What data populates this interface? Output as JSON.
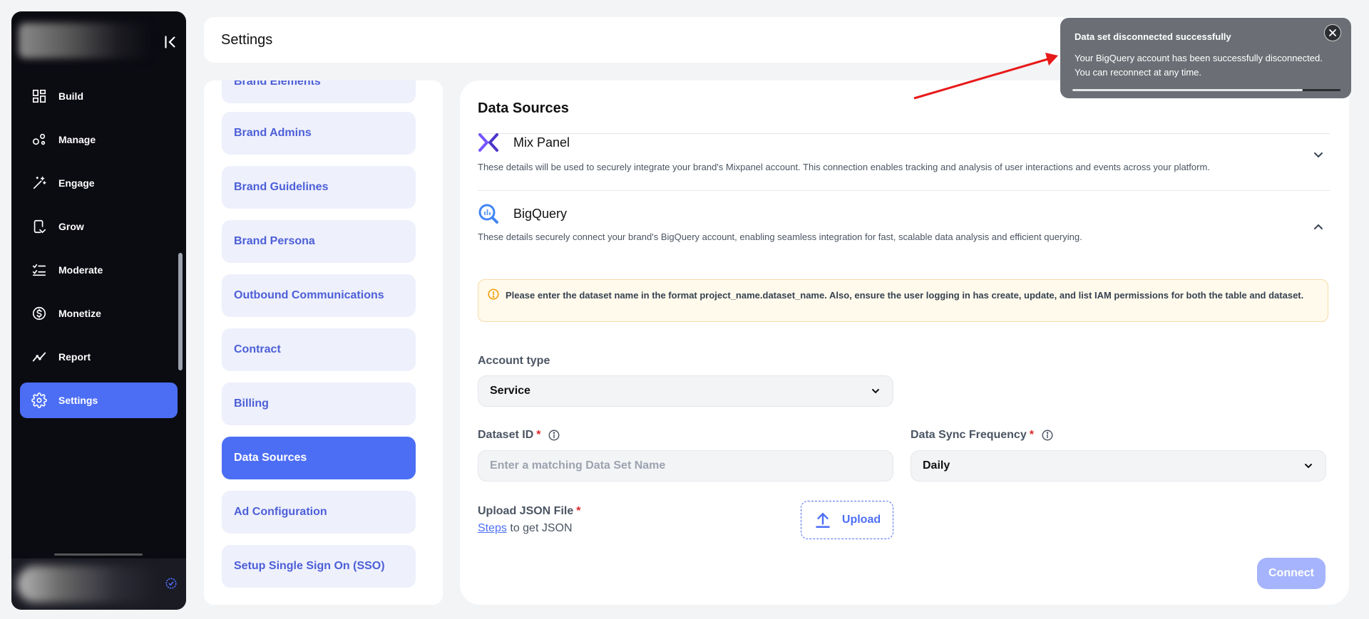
{
  "nav": {
    "items": [
      {
        "label": "Build",
        "icon": "grid-icon"
      },
      {
        "label": "Manage",
        "icon": "nodes-icon"
      },
      {
        "label": "Engage",
        "icon": "magic-wand-icon"
      },
      {
        "label": "Grow",
        "icon": "device-arrow-icon"
      },
      {
        "label": "Moderate",
        "icon": "checklist-icon"
      },
      {
        "label": "Monetize",
        "icon": "dollar-icon"
      },
      {
        "label": "Report",
        "icon": "trend-icon"
      },
      {
        "label": "Settings",
        "icon": "gear-icon",
        "active": true
      }
    ]
  },
  "header": {
    "title": "Settings"
  },
  "subnav": {
    "items": [
      {
        "label": "Brand Elements"
      },
      {
        "label": "Brand Admins"
      },
      {
        "label": "Brand Guidelines"
      },
      {
        "label": "Brand Persona"
      },
      {
        "label": "Outbound Communications"
      },
      {
        "label": "Contract"
      },
      {
        "label": "Billing"
      },
      {
        "label": "Data Sources",
        "active": true
      },
      {
        "label": "Ad Configuration"
      },
      {
        "label": "Setup Single Sign On (SSO)"
      }
    ]
  },
  "main": {
    "title": "Data Sources",
    "sources": [
      {
        "name": "Mix Panel",
        "description": "These details will be used to securely integrate your brand's Mixpanel account. This connection enables tracking and analysis of user interactions and events across your platform.",
        "expanded": false
      },
      {
        "name": "BigQuery",
        "description": "These details securely connect your brand's BigQuery account, enabling seamless integration for fast, scalable data analysis and efficient querying.",
        "expanded": true
      }
    ],
    "warning": "Please enter the dataset name in the format project_name.dataset_name. Also, ensure the user logging in has create, update, and list IAM permissions for both the table and dataset.",
    "account_type": {
      "label": "Account type",
      "value": "Service"
    },
    "dataset_id": {
      "label": "Dataset ID",
      "required_mark": "*",
      "placeholder": "Enter a matching Data Set Name",
      "value": ""
    },
    "sync_frequency": {
      "label": "Data Sync Frequency",
      "required_mark": "*",
      "value": "Daily"
    },
    "upload": {
      "label": "Upload JSON File",
      "required_mark": "*",
      "steps_link": "Steps",
      "steps_suffix": " to get JSON",
      "button_label": "Upload"
    },
    "connect_label": "Connect"
  },
  "toast": {
    "title": "Data set disconnected successfully",
    "message": "Your BigQuery account has been successfully disconnected. You can reconnect at any time.",
    "progress": 0.86
  },
  "colors": {
    "accent": "#4c6ef5",
    "nav_bg": "#0b0b12",
    "toast_bg": "#6b6f75",
    "warning_bg": "#fffaeb",
    "annotation_arrow": "#e81919"
  }
}
